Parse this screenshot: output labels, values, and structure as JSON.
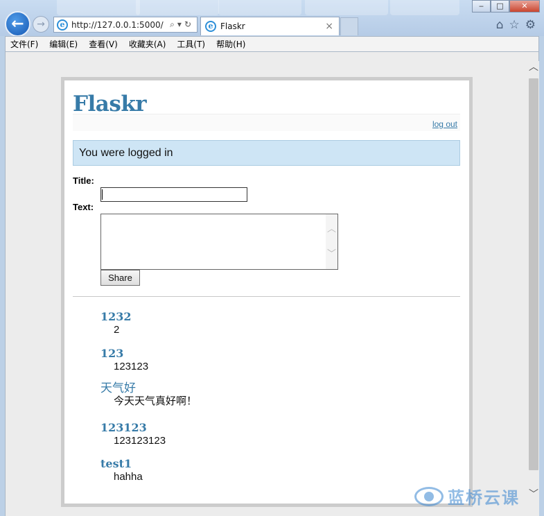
{
  "browser": {
    "address_url": "http://127.0.0.1:5000/",
    "tab_title": "Flaskr",
    "tab_close": "×",
    "menu": [
      "文件(F)",
      "编辑(E)",
      "查看(V)",
      "收藏夹(A)",
      "工具(T)",
      "帮助(H)"
    ]
  },
  "page": {
    "title": "Flaskr",
    "logout_label": "log out",
    "flash_message": "You were logged in",
    "form": {
      "title_label": "Title:",
      "text_label": "Text:",
      "title_value": "",
      "text_value": "",
      "share_label": "Share"
    },
    "entries": [
      {
        "title": "1232",
        "text": "2"
      },
      {
        "title": "123",
        "text": "123123"
      },
      {
        "title": "天气好",
        "text": "今天天气真好啊！"
      },
      {
        "title": "123123",
        "text": "123123123"
      },
      {
        "title": "test1",
        "text": "hahha"
      }
    ]
  },
  "watermark": {
    "text": "蓝桥云课"
  },
  "colors": {
    "link": "#377ba8",
    "flash_bg": "#cee5f5",
    "page_border": "#cccccc"
  }
}
